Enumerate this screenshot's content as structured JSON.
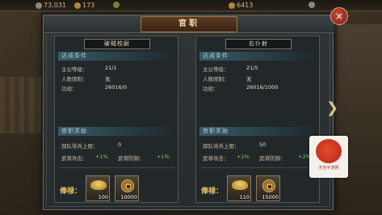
{
  "topbar": {
    "resources": [
      "73,031",
      "173",
      "",
      "6413",
      ""
    ]
  },
  "dialog": {
    "title": "官职",
    "close_label": "×",
    "next_label": "❯"
  },
  "panels": [
    {
      "rank": "破贼校尉",
      "requirements_title": "达成条件",
      "lord_level_label": "主公等级：",
      "lord_level_value": "21/1",
      "count_label": "人数限制：",
      "count_value": "无",
      "merit_label": "功勋：",
      "merit_value": "26016/0",
      "rewards_title": "官职奖励",
      "troop_label": "部队带兵上限：",
      "troop_value": "0",
      "attack_label": "武将攻击：",
      "attack_value": "+1%",
      "defense_label": "武将防御：",
      "defense_value": "+1%",
      "salary_label": "俸禄：",
      "items": [
        {
          "icon": "gold-ingot-icon",
          "qty": "100"
        },
        {
          "icon": "copper-coin-icon",
          "qty": "10000"
        }
      ]
    },
    {
      "rank": "右仆射",
      "requirements_title": "达成条件",
      "lord_level_label": "主公等级：",
      "lord_level_value": "21/5",
      "count_label": "人数限制：",
      "count_value": "无",
      "merit_label": "功勋：",
      "merit_value": "26016/1000",
      "rewards_title": "官职奖励",
      "troop_label": "部队带兵上限：",
      "troop_value": "50",
      "attack_label": "武将攻击：",
      "attack_value": "+2%",
      "defense_label": "武将防御：",
      "defense_value": "+2%",
      "salary_label": "俸禄：",
      "items": [
        {
          "icon": "gold-ingot-icon",
          "qty": "110"
        },
        {
          "icon": "copper-coin-icon",
          "qty": "15000"
        }
      ]
    }
  ],
  "watermark": {
    "text": "天空手游网"
  }
}
